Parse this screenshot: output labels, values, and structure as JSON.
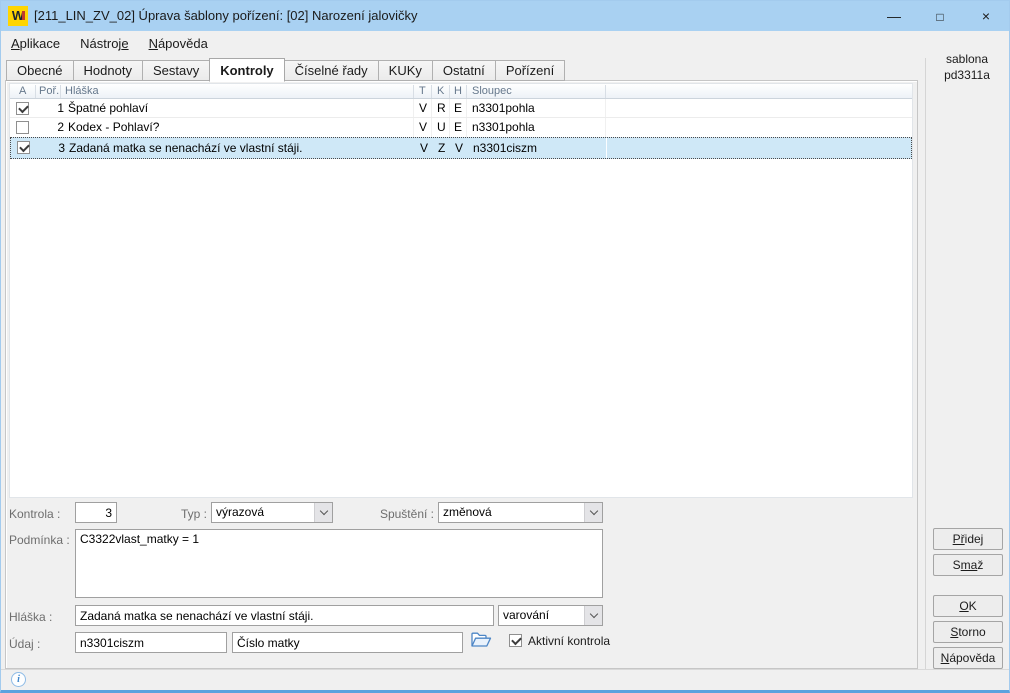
{
  "colors": {
    "titlebar": "#a9d1f2",
    "window_border_bottom": "#5ba2de",
    "selection_row": "#cfe8f7",
    "grid_header_text": "#66788c",
    "app_icon_bg": "#ffd500",
    "folder_icon_blue": "#4d86c6"
  },
  "titlebar": {
    "logo": "W",
    "title": "[211_LIN_ZV_02] Úprava šablony pořízení: [02] Narození jalovičky",
    "minimize_glyph": "—",
    "maximize_glyph": "□",
    "close_glyph": "×"
  },
  "menu": {
    "items": [
      {
        "pre": "",
        "key": "A",
        "post": "plikace"
      },
      {
        "pre": "Nástroj",
        "key": "e",
        "post": ""
      },
      {
        "pre": "",
        "key": "N",
        "post": "ápověda"
      }
    ]
  },
  "tabs": {
    "active": "Kontroly",
    "items": [
      "Obecné",
      "Hodnoty",
      "Sestavy",
      "Kontroly",
      "Číselné řady",
      "KUKy",
      "Ostatní",
      "Pořízení"
    ]
  },
  "side_panel": {
    "line1": "sablona",
    "line2": "pd3311a"
  },
  "grid": {
    "headers": {
      "a": "A",
      "por": "Poř.",
      "hlaska": "Hláška",
      "t": "T",
      "k": "K",
      "h": "H",
      "sloupec": "Sloupec"
    },
    "rows": [
      {
        "checked": true,
        "num": "1",
        "hlaska": "Špatné pohlaví",
        "t": "V",
        "k": "R",
        "h": "E",
        "sloupec": "n3301pohla",
        "selected": false
      },
      {
        "checked": false,
        "num": "2",
        "hlaska": "Kodex - Pohlaví?",
        "t": "V",
        "k": "U",
        "h": "E",
        "sloupec": "n3301pohla",
        "selected": false
      },
      {
        "checked": true,
        "num": "3",
        "hlaska": "Zadaná matka se nenachází ve vlastní stáji.",
        "t": "V",
        "k": "Z",
        "h": "V",
        "sloupec": "n3301ciszm",
        "selected": true
      }
    ]
  },
  "form": {
    "kontrola_label": "Kontrola :",
    "kontrola_value": "3",
    "typ_label": "Typ :",
    "typ_value": "výrazová",
    "spusteni_label": "Spuštění :",
    "spusteni_value": "změnová",
    "podminka_label": "Podmínka :",
    "podminka_value": "C3322vlast_matky = 1",
    "hlaska_label": "Hláška :",
    "hlaska_value": "Zadaná matka se nenachází ve vlastní stáji.",
    "zavaznost_value": "varování",
    "udaj_label": "Údaj :",
    "udaj_code": "n3301ciszm",
    "udaj_name": "Číslo matky",
    "aktivni_label": "Aktivní kontrola",
    "aktivni_checked": true
  },
  "action_buttons": {
    "pridej": {
      "pre": "",
      "key": "Př",
      "post": "idej"
    },
    "smaz": {
      "pre": "S",
      "key": "ma",
      "post": "ž"
    },
    "ok": {
      "pre": "",
      "key": "O",
      "post": "K"
    },
    "storno": {
      "pre": "",
      "key": "S",
      "post": "torno"
    },
    "napoveda": {
      "pre": "",
      "key": "N",
      "post": "ápověda"
    }
  },
  "statusbar": {
    "info_glyph": "i"
  }
}
